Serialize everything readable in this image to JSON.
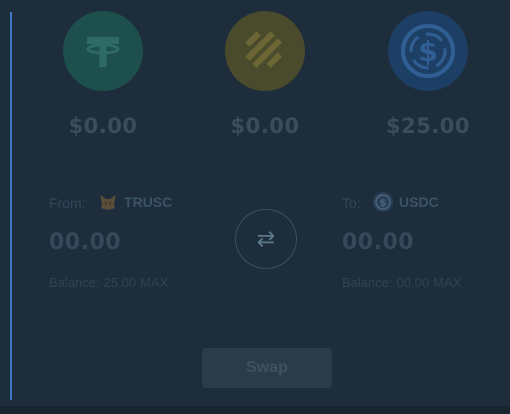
{
  "colors": {
    "background": "#1d2d3b",
    "accent_line": "#3f78c6",
    "usdt_circle": "#1d4f4c",
    "busd_circle": "#4a4a2c",
    "usdc_circle": "#1d3f66"
  },
  "coins": [
    {
      "icon": "tether-icon",
      "balance": "$0.00"
    },
    {
      "icon": "busd-icon",
      "balance": "$0.00"
    },
    {
      "icon": "usdc-icon",
      "balance": "$25.00"
    }
  ],
  "from": {
    "label": "From:",
    "token_icon": "fox-icon",
    "token": "TRUSC",
    "amount": "00.00",
    "balance_label": "Balance:",
    "balance_value": "25.00",
    "max_label": "MAX"
  },
  "to": {
    "label": "To:",
    "token_icon": "usdc-icon",
    "token": "USDC",
    "amount": "00.00",
    "balance_label": "Balance:",
    "balance_value": "00.00",
    "max_label": "MAX"
  },
  "swap_direction_icon": "⇄",
  "swap_button_label": "Swap"
}
